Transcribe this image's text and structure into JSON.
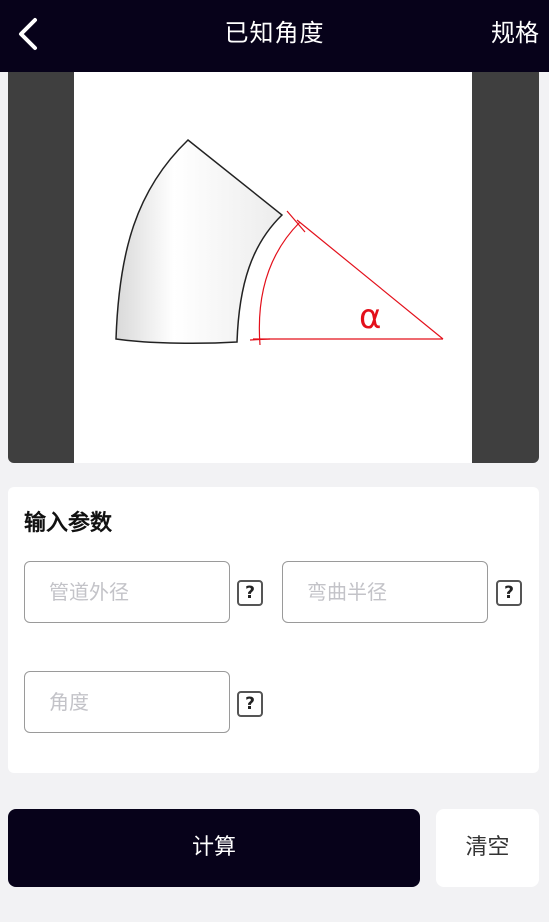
{
  "header": {
    "title": "已知角度",
    "spec_label": "规格"
  },
  "diagram": {
    "angle_symbol": "α",
    "line_color": "#e3101b"
  },
  "params": {
    "section_title": "输入参数",
    "fields": [
      {
        "placeholder": "管道外径",
        "help": "?"
      },
      {
        "placeholder": "弯曲半径",
        "help": "?"
      },
      {
        "placeholder": "角度",
        "help": "?"
      }
    ]
  },
  "actions": {
    "calculate_label": "计算",
    "clear_label": "清空"
  },
  "colors": {
    "header_bg": "#07021a",
    "accent": "#07021a",
    "page_bg": "#f2f2f4"
  }
}
